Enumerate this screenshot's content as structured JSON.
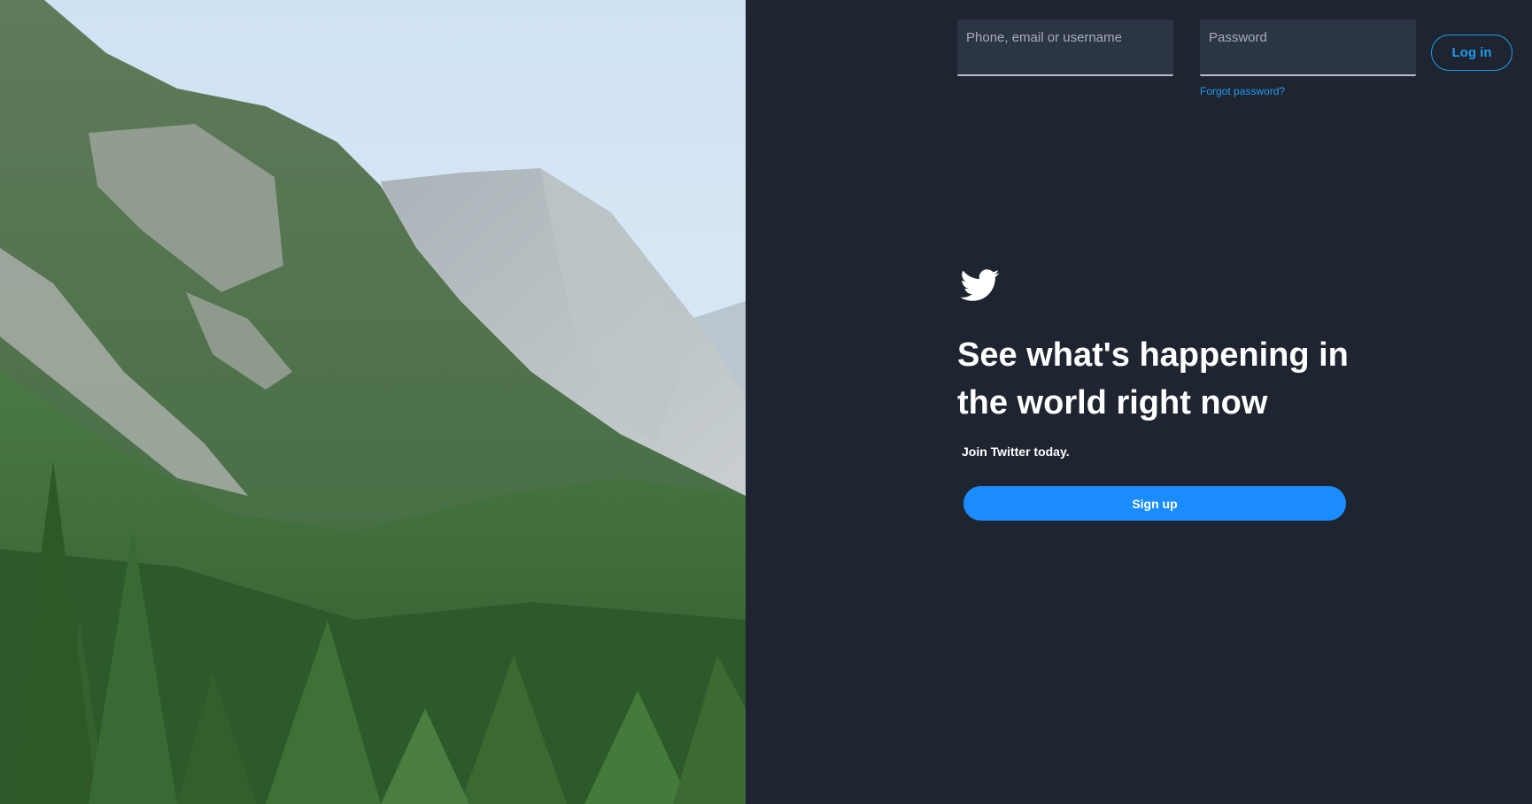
{
  "login": {
    "phone_placeholder": "Phone, email or username",
    "phone_value": "",
    "password_placeholder": "Password",
    "password_value": "",
    "forgot_label": "Forgot password?",
    "login_label": "Log in"
  },
  "hero": {
    "logo_icon": "twitter-bird-icon",
    "headline_line1": "See what's happening in",
    "headline_line2": "the world right now",
    "tagline": "Join Twitter today.",
    "signup_label": "Sign up"
  },
  "colors": {
    "background": "#1f2530",
    "accent": "#1d9bf0",
    "signup_button": "#1a8cff",
    "input_bg": "#2c3545"
  }
}
